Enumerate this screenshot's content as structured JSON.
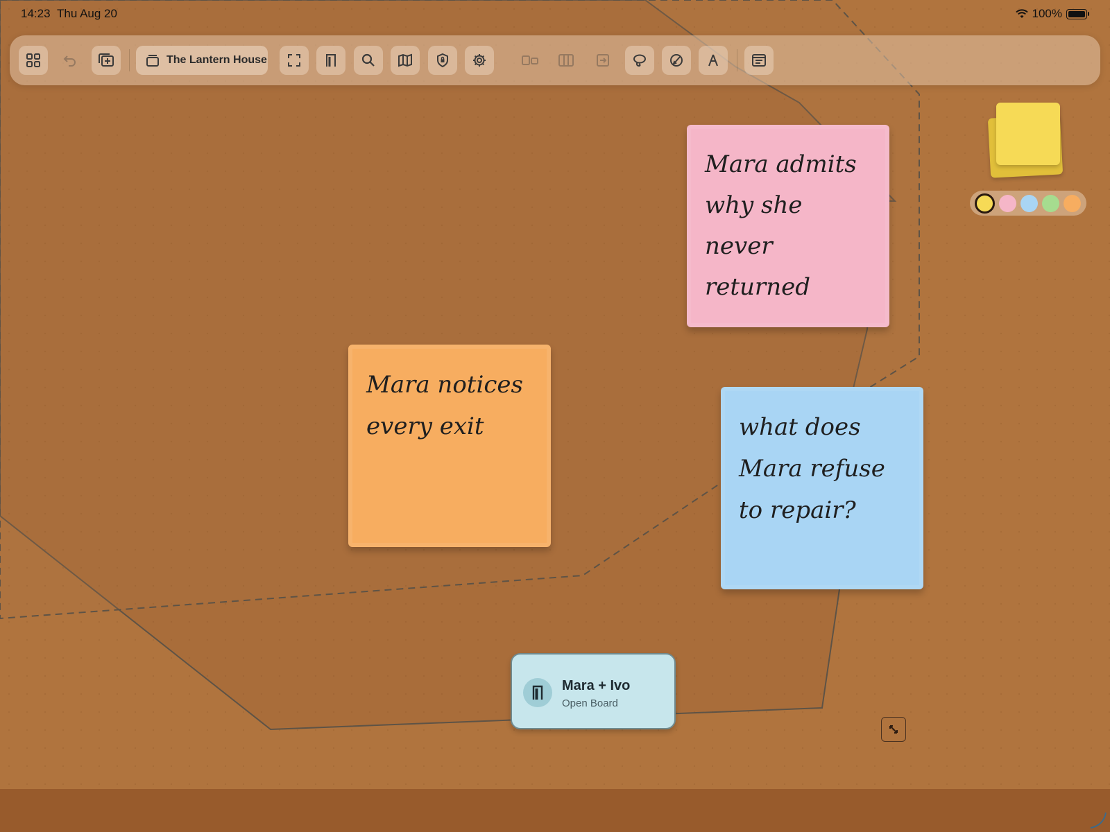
{
  "status_bar": {
    "time": "14:23",
    "date": "Thu Aug 20",
    "battery": "100%"
  },
  "toolbar": {
    "title": "The Lantern House",
    "buttons": [
      {
        "name": "grid-view",
        "icon": "grid-icon",
        "enabled": true
      },
      {
        "name": "undo",
        "icon": "undo-icon",
        "enabled": false
      },
      {
        "name": "add-board",
        "icon": "add-window-icon",
        "enabled": true
      },
      {
        "name": "fullscreen",
        "icon": "fullscreen-icon",
        "enabled": true
      },
      {
        "name": "board",
        "icon": "board-icon",
        "enabled": true
      },
      {
        "name": "search",
        "icon": "search-icon",
        "enabled": true
      },
      {
        "name": "map",
        "icon": "map-icon",
        "enabled": true
      },
      {
        "name": "shield",
        "icon": "shield-icon",
        "enabled": true
      },
      {
        "name": "settings",
        "icon": "gear-icon",
        "enabled": true
      },
      {
        "name": "layout-split",
        "icon": "split-icon",
        "enabled": false
      },
      {
        "name": "columns",
        "icon": "columns-icon",
        "enabled": false
      },
      {
        "name": "move-to",
        "icon": "move-icon",
        "enabled": false
      },
      {
        "name": "lasso",
        "icon": "lasso-icon",
        "enabled": true
      },
      {
        "name": "draw",
        "icon": "pencil-circle-icon",
        "enabled": true
      },
      {
        "name": "pen",
        "icon": "pen-icon",
        "enabled": true
      },
      {
        "name": "inspector",
        "icon": "panel-icon",
        "enabled": true
      }
    ]
  },
  "notes": [
    {
      "id": "pink",
      "text": "Mara admits why she never returned",
      "color": "#f5b6c8"
    },
    {
      "id": "orange",
      "text": "Mara notices every exit",
      "color": "#f7ad60"
    },
    {
      "id": "blue",
      "text": "what does Mara refuse to repair?",
      "color": "#a9d5f4"
    }
  ],
  "board_card": {
    "title": "Mara + Ivo",
    "subtitle": "Open Board"
  },
  "note_colors": [
    "#f6da56",
    "#f5b6c8",
    "#a9d5f4",
    "#a6dc8f",
    "#f7ad60"
  ],
  "selected_note_color": "#f6da56"
}
